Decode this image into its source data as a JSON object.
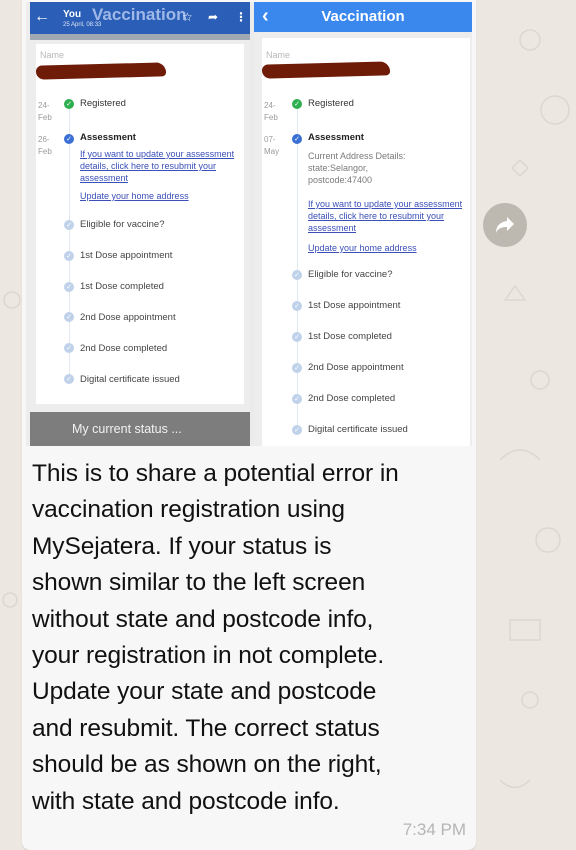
{
  "left_screen": {
    "header": {
      "back_icon": "back-arrow-icon",
      "sender": "You",
      "datetime": "25 April, 08:33",
      "title": "Vaccination",
      "star_icon": "star-icon",
      "share_icon": "share-icon",
      "more_icon": "more-vert-icon"
    },
    "name_label": "Name",
    "timeline": [
      {
        "date": "24-\nFeb",
        "label": "Registered",
        "status": "done"
      },
      {
        "date": "26-\nFeb",
        "label": "Assessment",
        "status": "current",
        "links": [
          "If you want to update your assessment details, click here to resubmit your assessment",
          "Update your home address"
        ]
      },
      {
        "date": "",
        "label": "Eligible for vaccine?",
        "status": "pending"
      },
      {
        "date": "",
        "label": "1st Dose appointment",
        "status": "pending"
      },
      {
        "date": "",
        "label": "1st Dose completed",
        "status": "pending"
      },
      {
        "date": "",
        "label": "2nd Dose appointment",
        "status": "pending"
      },
      {
        "date": "",
        "label": "2nd Dose completed",
        "status": "pending"
      },
      {
        "date": "",
        "label": "Digital certificate issued",
        "status": "pending"
      }
    ],
    "caption": "My current status ..."
  },
  "right_screen": {
    "header": {
      "back_icon": "back-chevron-icon",
      "title": "Vaccination"
    },
    "name_label": "Name",
    "timeline": [
      {
        "date": "24-\nFeb",
        "label": "Registered",
        "status": "done"
      },
      {
        "date": "07-\nMay",
        "label": "Assessment",
        "status": "current",
        "details": "Current Address Details:\nstate:Selangor,\npostcode:47400",
        "links": [
          "If you want to update your assessment details, click here to resubmit your assessment",
          "Update your home address"
        ]
      },
      {
        "date": "",
        "label": "Eligible for vaccine?",
        "status": "pending"
      },
      {
        "date": "",
        "label": "1st Dose appointment",
        "status": "pending"
      },
      {
        "date": "",
        "label": "1st Dose completed",
        "status": "pending"
      },
      {
        "date": "",
        "label": "2nd Dose appointment",
        "status": "pending"
      },
      {
        "date": "",
        "label": "2nd Dose completed",
        "status": "pending"
      },
      {
        "date": "",
        "label": "Digital certificate issued",
        "status": "pending"
      }
    ]
  },
  "message": {
    "text": "This is to share a potential error in\nvaccination registration using\nMySejatera.  If your status is\nshown similar to the left screen\nwithout state and postcode info,\nyour registration in not complete.\nUpdate your state and postcode\nand resubmit.  The correct status\nshould be as shown on the right,\nwith state and postcode info.",
    "time": "7:34 PM"
  },
  "forward_button": {
    "icon": "forward-icon"
  },
  "colors": {
    "left_header": "#2a5eb7",
    "right_header": "#3a87ee",
    "done_green": "#2fb050",
    "current_blue": "#3a6fd3",
    "pending_blue": "#bfd2ea",
    "link": "#3a4fb8",
    "wallpaper": "#ece8e1",
    "bubble": "#f7f7f7"
  }
}
